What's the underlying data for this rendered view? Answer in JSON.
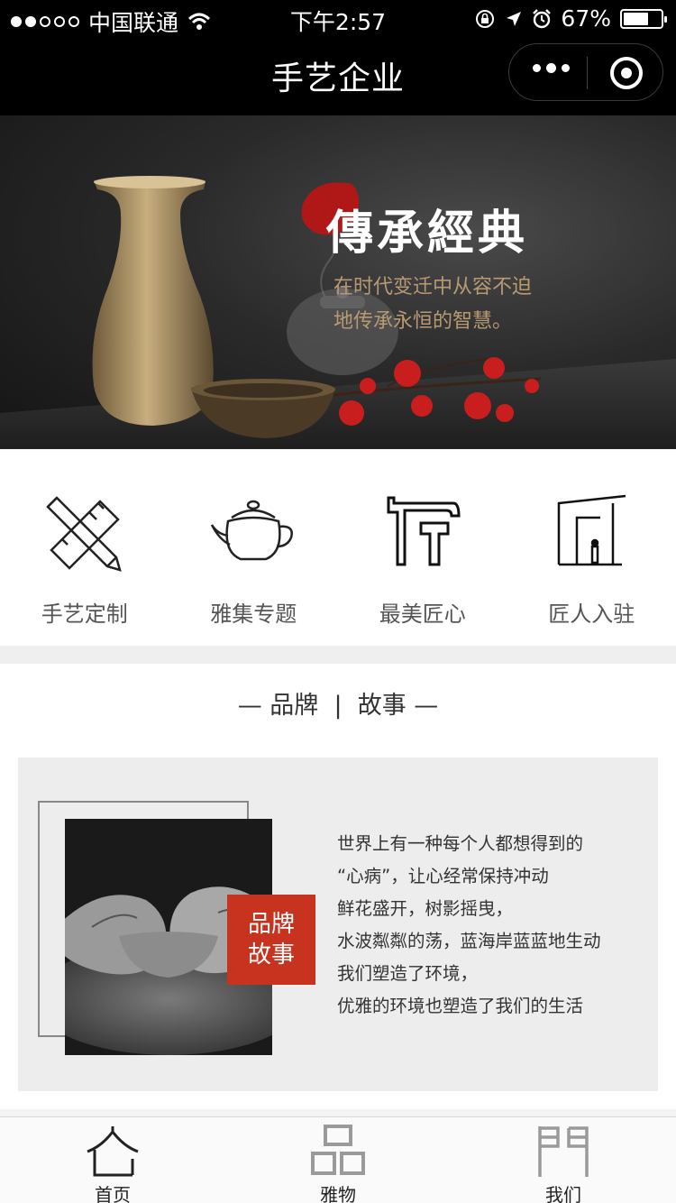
{
  "status_bar": {
    "carrier": "中国联通",
    "time": "下午2:57",
    "battery": "67%",
    "battery_level": 0.67
  },
  "nav": {
    "title": "手艺企业"
  },
  "banner": {
    "title": "傳承經典",
    "subtitle_line1": "在时代变迁中从容不迫",
    "subtitle_line2": "地传承永恒的智慧。"
  },
  "categories": [
    {
      "label": "手艺定制",
      "icon": "pencil-ruler-icon"
    },
    {
      "label": "雅集专题",
      "icon": "teapot-icon"
    },
    {
      "label": "最美匠心",
      "icon": "hammer-icon"
    },
    {
      "label": "匠人入驻",
      "icon": "doorway-icon"
    }
  ],
  "brand_story": {
    "section_left": "品牌",
    "section_right": "故事",
    "tag_line1": "品牌",
    "tag_line2": "故事",
    "text": [
      "世界上有一种每个人都想得到的",
      "“心病”，让心经常保持冲动",
      "鲜花盛开，树影摇曳，",
      "水波粼粼的荡，蓝海岸蓝蓝地生动",
      "我们塑造了环境，",
      "优雅的环境也塑造了我们的生活"
    ]
  },
  "tabs": [
    {
      "label": "首页",
      "icon": "home-icon",
      "active": true
    },
    {
      "label": "雅物",
      "icon": "goods-icon",
      "active": false
    },
    {
      "label": "我们",
      "icon": "gate-icon",
      "active": false
    }
  ],
  "colors": {
    "accent_red": "#c8331f",
    "banner_subtitle": "#b89a72",
    "bar_black": "#000000"
  }
}
